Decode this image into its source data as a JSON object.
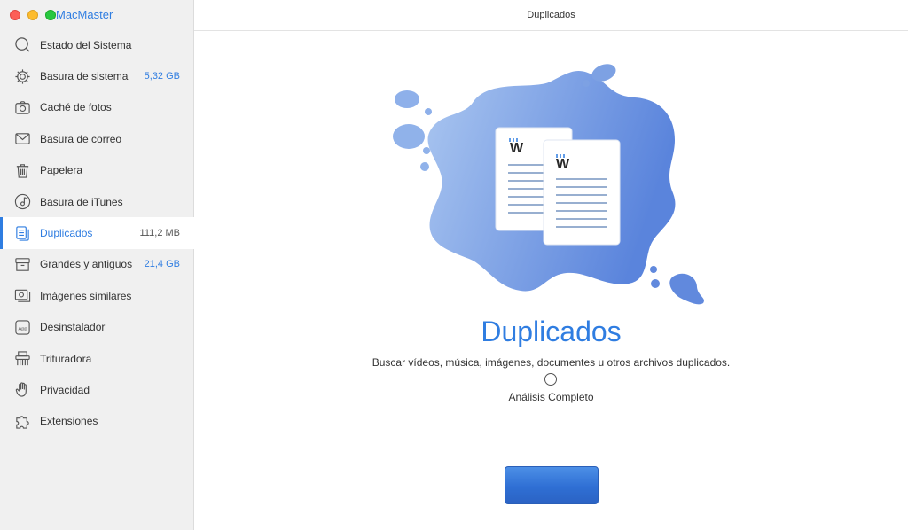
{
  "app": {
    "title": "MacMaster"
  },
  "sidebar": {
    "items": [
      {
        "label": "Estado del Sistema",
        "size": "",
        "icon": "search-icon"
      },
      {
        "label": "Basura de sistema",
        "size": "5,32 GB",
        "icon": "gear-icon"
      },
      {
        "label": "Caché de fotos",
        "size": "",
        "icon": "camera-icon"
      },
      {
        "label": "Basura de correo",
        "size": "",
        "icon": "mail-icon"
      },
      {
        "label": "Papelera",
        "size": "",
        "icon": "trash-icon"
      },
      {
        "label": "Basura de iTunes",
        "size": "",
        "icon": "music-icon"
      },
      {
        "label": "Duplicados",
        "size": "111,2 MB",
        "icon": "duplicate-icon",
        "active": true
      },
      {
        "label": "Grandes y antiguos",
        "size": "21,4 GB",
        "icon": "archive-icon"
      },
      {
        "label": "Imágenes similares",
        "size": "",
        "icon": "image-icon"
      },
      {
        "label": "Desinstalador",
        "size": "",
        "icon": "app-icon"
      },
      {
        "label": "Trituradora",
        "size": "",
        "icon": "shredder-icon"
      },
      {
        "label": "Privacidad",
        "size": "",
        "icon": "hand-icon"
      },
      {
        "label": "Extensiones",
        "size": "",
        "icon": "puzzle-icon"
      }
    ]
  },
  "main": {
    "header_title": "Duplicados",
    "title": "Duplicados",
    "description": "Buscar vídeos, música, imágenes, documentes u otros archivos duplicados.",
    "scan_option_label": "Análisis Completo",
    "scan_button_label": ""
  },
  "colors": {
    "accent": "#2f7de1",
    "sidebar_bg": "#f0f0f0",
    "blob_start": "#a7c3ef",
    "blob_end": "#5b85dc"
  }
}
